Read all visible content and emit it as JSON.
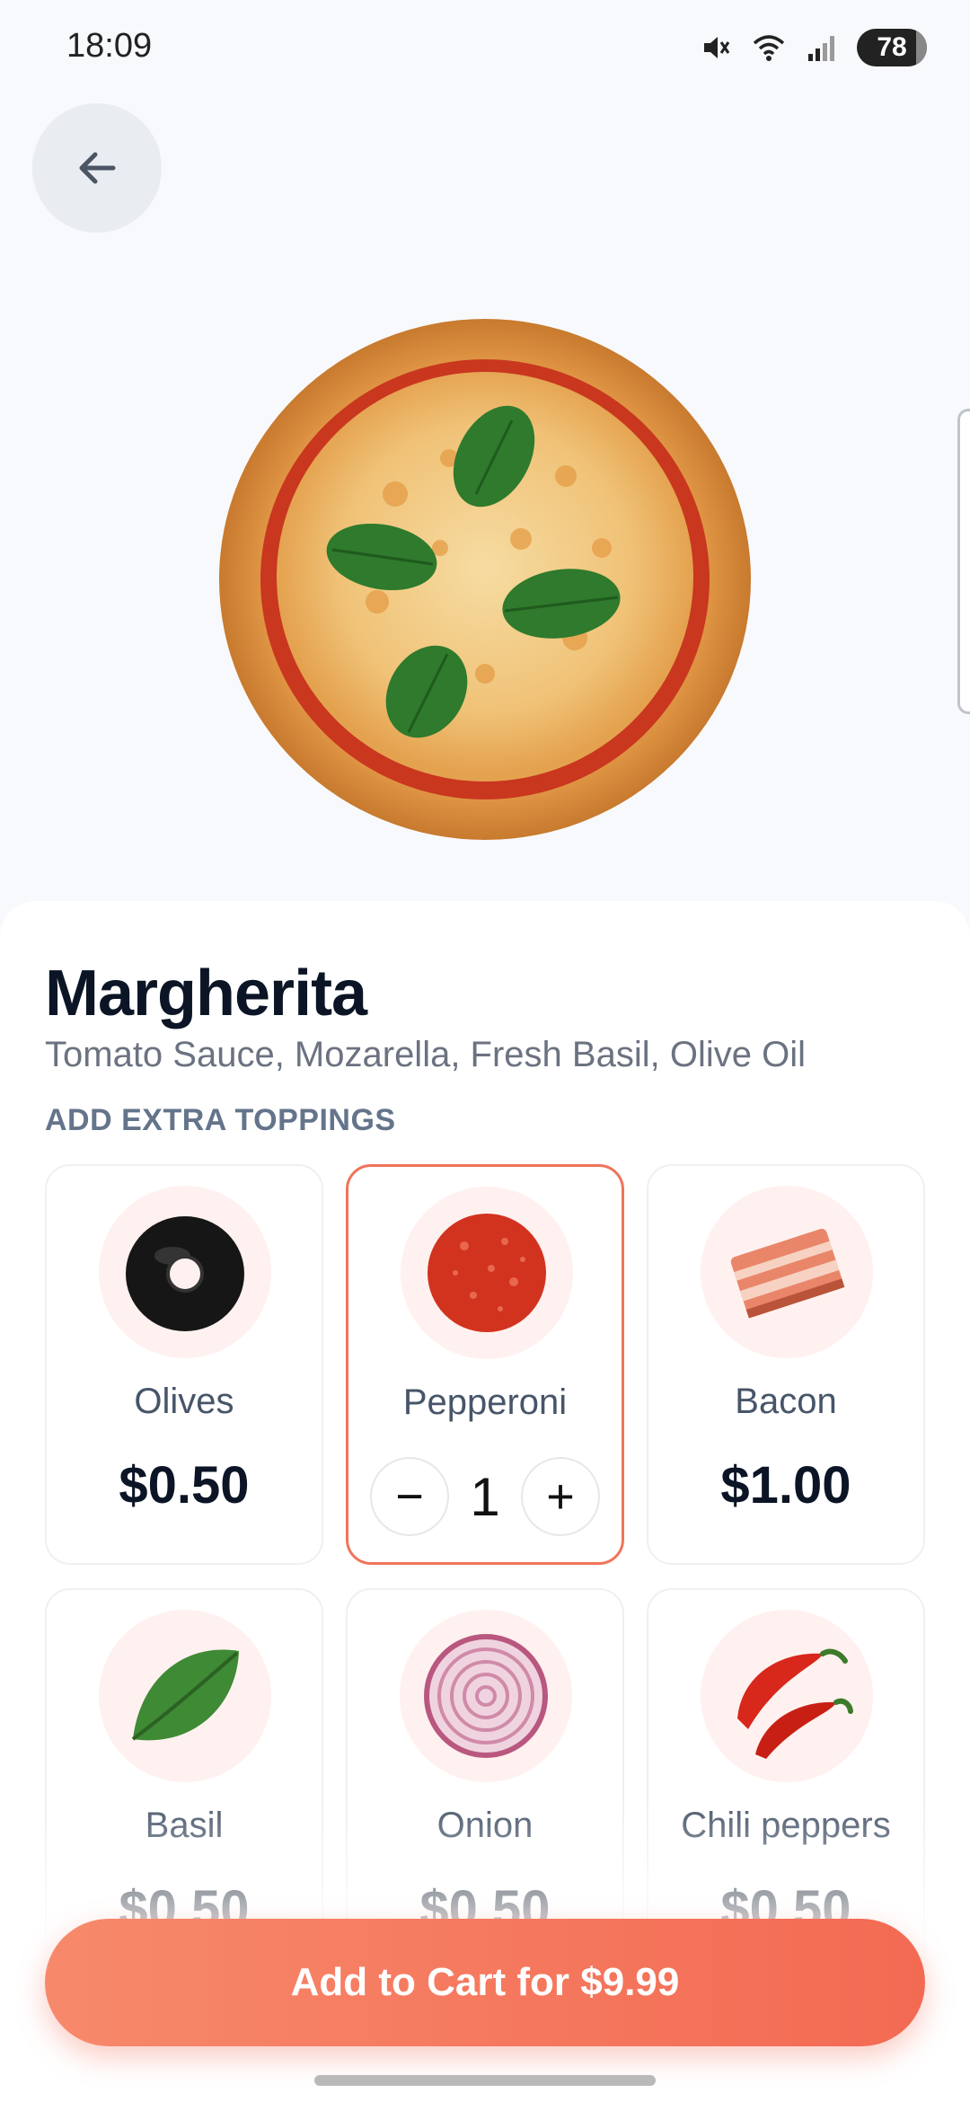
{
  "status_bar": {
    "time": "18:09",
    "battery": "78"
  },
  "navigation": {
    "back_icon": "arrow-left-icon"
  },
  "product": {
    "name": "Margherita",
    "description": "Tomato Sauce, Mozarella, Fresh Basil, Olive Oil"
  },
  "toppings_section": {
    "label": "ADD EXTRA TOPPINGS",
    "items": [
      {
        "name": "Olives",
        "price": "$0.50",
        "selected": false
      },
      {
        "name": "Pepperoni",
        "quantity": "1",
        "selected": true
      },
      {
        "name": "Bacon",
        "price": "$1.00",
        "selected": false
      },
      {
        "name": "Basil",
        "price": "$0.50",
        "selected": false
      },
      {
        "name": "Onion",
        "price": "$0.50",
        "selected": false
      },
      {
        "name": "Chili peppers",
        "price": "$0.50",
        "selected": false
      }
    ]
  },
  "stepper": {
    "minus": "−",
    "plus": "+"
  },
  "cart_button": {
    "label": "Add to Cart for $9.99"
  },
  "colors": {
    "accent": "#f36a53",
    "selected_border": "#f0745a",
    "thumb_bg": "#fff1ef"
  }
}
